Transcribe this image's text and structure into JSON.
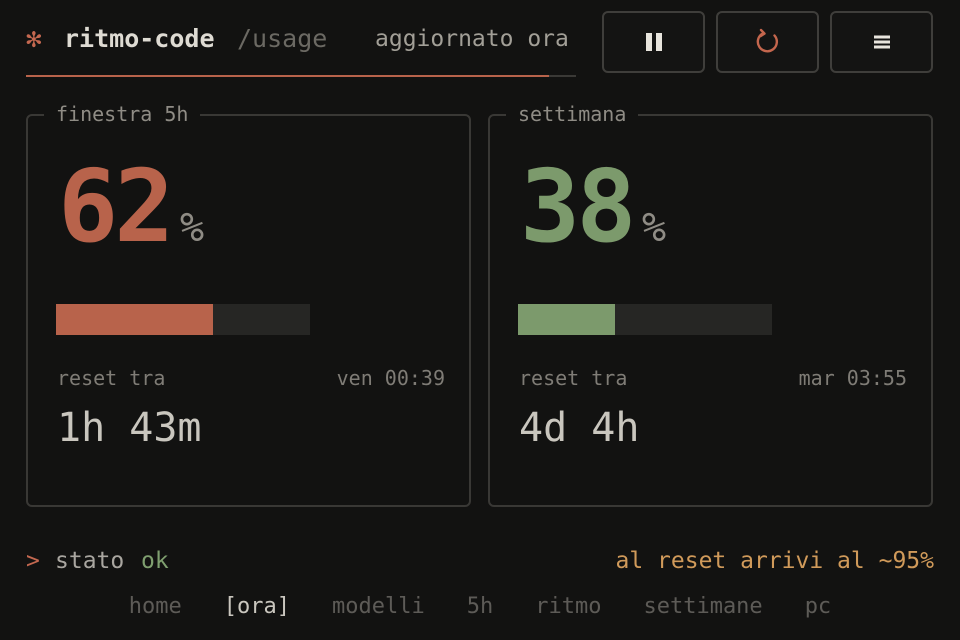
{
  "header": {
    "logo_glyph": "✻",
    "app_name": "ritmo-code",
    "path": "/usage",
    "updated": "aggiornato ora",
    "progress": 0.95
  },
  "buttons": {
    "pause_icon": "pause-icon",
    "refresh_icon": "refresh-icon",
    "menu_icon": "menu-icon"
  },
  "panels": [
    {
      "title": "finestra 5h",
      "percent": "62",
      "percent_value": 62,
      "percent_sign": "%",
      "color": "#b8634b",
      "reset_label": "reset tra",
      "reset_time": "ven 00:39",
      "countdown": "1h 43m"
    },
    {
      "title": "settimana",
      "percent": "38",
      "percent_value": 38,
      "percent_sign": "%",
      "color": "#7c9a6c",
      "reset_label": "reset tra",
      "reset_time": "mar 03:55",
      "countdown": "4d 4h"
    }
  ],
  "status": {
    "prompt": ">",
    "label": "stato",
    "value": "ok",
    "forecast": "al reset arrivi al ~95%"
  },
  "nav": {
    "items": [
      "home",
      "[ora]",
      "modelli",
      "5h",
      "ritmo",
      "settimane",
      "pc"
    ],
    "active_index": 1
  }
}
